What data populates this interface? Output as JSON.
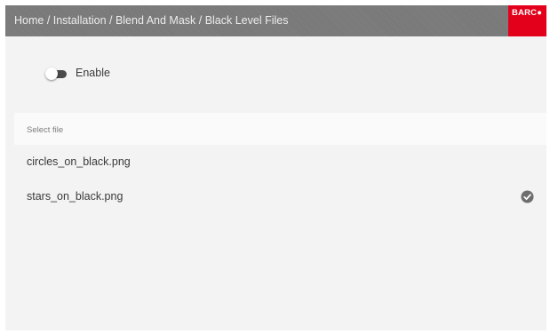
{
  "header": {
    "breadcrumb": "Home / Installation / Blend And Mask / Black Level Files",
    "logo_text": "BARC●"
  },
  "enable_toggle": {
    "label": "Enable",
    "state": "off"
  },
  "file_list": {
    "section_label": "Select file",
    "items": [
      {
        "name": "circles_on_black.png",
        "selected": false
      },
      {
        "name": "stars_on_black.png",
        "selected": true,
        "icon": "check-circle-icon"
      }
    ]
  },
  "colors": {
    "header_bg": "#7a7a7a",
    "logo_bg": "#e2001a",
    "background": "#f3f3f3",
    "check": "#6e6e6e"
  }
}
